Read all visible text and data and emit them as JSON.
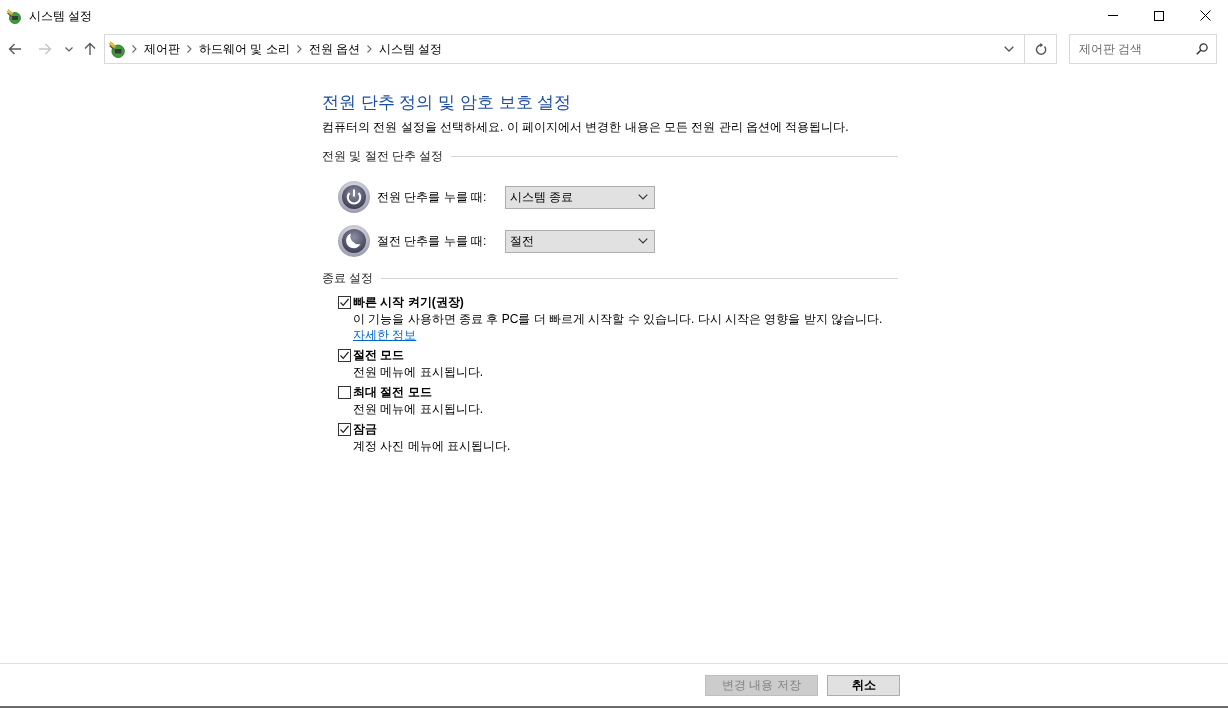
{
  "window": {
    "title": "시스템 설정"
  },
  "nav": [
    {
      "kind": "back",
      "disabled": false
    },
    {
      "kind": "forward",
      "disabled": true
    },
    {
      "kind": "recent",
      "disabled": false
    },
    {
      "kind": "up",
      "disabled": false
    }
  ],
  "breadcrumb": [
    "제어판",
    "하드웨어 및 소리",
    "전원 옵션",
    "시스템 설정"
  ],
  "search": {
    "placeholder": "제어판 검색"
  },
  "page": {
    "heading": "전원 단추 정의 및 암호 보호 설정",
    "description": "컴퓨터의 전원 설정을 선택하세요. 이 페이지에서 변경한 내용은 모든 전원 관리 옵션에 적용됩니다."
  },
  "button_settings": {
    "title": "전원 및 절전 단추 설정",
    "rows": [
      {
        "kind": "power",
        "label": "전원 단추를 누를 때:",
        "value": "시스템 종료"
      },
      {
        "kind": "sleep",
        "label": "절전 단추를 누를 때:",
        "value": "절전"
      }
    ]
  },
  "shutdown_settings": {
    "title": "종료 설정",
    "options": [
      {
        "label": "빠른 시작 켜기(권장)",
        "checked": true,
        "description": "이 기능을 사용하면 종료 후 PC를 더 빠르게 시작할 수 있습니다. 다시 시작은 영향을 받지 않습니다.",
        "link": "자세한 정보"
      },
      {
        "label": "절전 모드",
        "checked": true,
        "description": "전원 메뉴에 표시됩니다."
      },
      {
        "label": "최대 절전 모드",
        "checked": false,
        "description": "전원 메뉴에 표시됩니다."
      },
      {
        "label": "잠금",
        "checked": true,
        "description": "계정 사진 메뉴에 표시됩니다."
      }
    ]
  },
  "footer_buttons": [
    {
      "label": "변경 내용 저장",
      "disabled": true
    },
    {
      "label": "취소",
      "disabled": false
    }
  ]
}
